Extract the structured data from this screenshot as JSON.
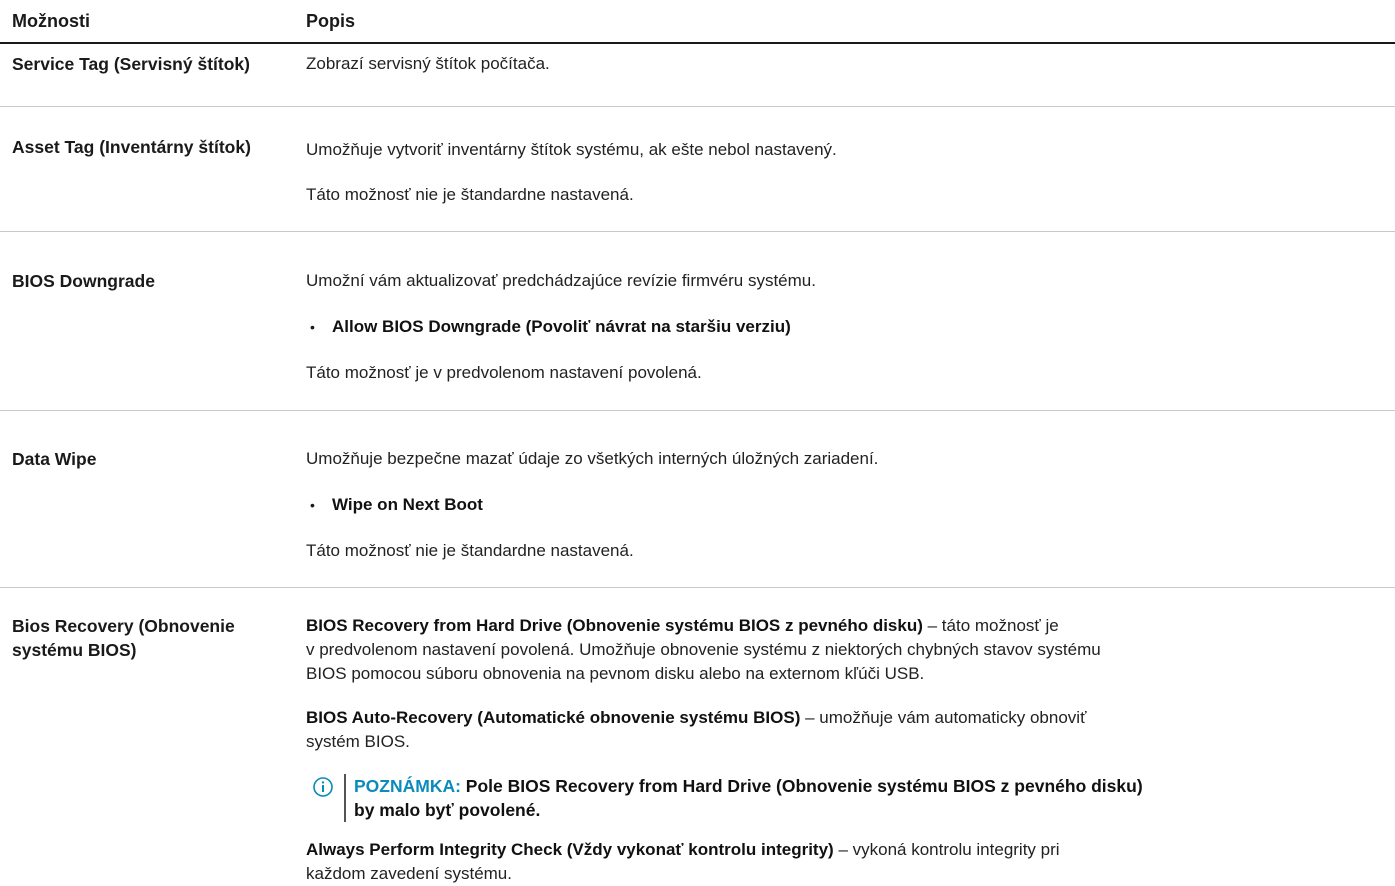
{
  "header": {
    "options_label": "Možnosti",
    "description_label": "Popis"
  },
  "rows": [
    {
      "option": "Service Tag (Servisný štítok)",
      "desc": [
        "Zobrazí servisný štítok počítača."
      ]
    },
    {
      "option": "Asset Tag (Inventárny štítok)",
      "desc": [
        "Umožňuje vytvoriť inventárny štítok systému, ak ešte nebol nastavený.",
        "Táto možnosť nie je štandardne nastavená."
      ]
    },
    {
      "option": "BIOS Downgrade",
      "desc": "Umožní vám aktualizovať predchádzajúce revízie firmvéru systému.",
      "bullet": "Allow BIOS Downgrade (Povoliť návrat na staršiu verziu)",
      "after": "Táto možnosť je v predvolenom nastavení povolená."
    },
    {
      "option": "Data Wipe",
      "desc": "Umožňuje bezpečne mazať údaje zo všetkých interných úložných zariadení.",
      "bullet": "Wipe on Next Boot",
      "after": "Táto možnosť nie je štandardne nastavená."
    },
    {
      "option": "Bios Recovery (Obnovenie systému BIOS)",
      "items": [
        {
          "bold": "BIOS Recovery from Hard Drive (Obnovenie systému BIOS z pevného disku)",
          "line1": " – táto možnosť je",
          "line2": "v predvolenom nastavení povolená. Umožňuje obnovenie systému z niektorých chybných stavov systému",
          "line3": "BIOS pomocou súboru obnovenia na pevnom disku alebo na externom kľúči USB."
        },
        {
          "bold": "BIOS Auto-Recovery (Automatické obnovenie systému BIOS)",
          "line1": " – umožňuje vám automaticky obnoviť",
          "line2": "systém BIOS."
        },
        {
          "bold": "Always Perform Integrity Check (Vždy vykonať kontrolu integrity)",
          "line1": " – vykoná kontrolu integrity pri",
          "line2": "každom zavedení systému."
        }
      ],
      "note": {
        "label": "POZNÁMKA:",
        "text1": " Pole BIOS Recovery from Hard Drive (Obnovenie systému BIOS z pevného disku)",
        "text2": "by malo byť povolené."
      }
    }
  ],
  "colors": {
    "note_accent": "#0a8bbd",
    "divider": "#c8c8c8"
  }
}
